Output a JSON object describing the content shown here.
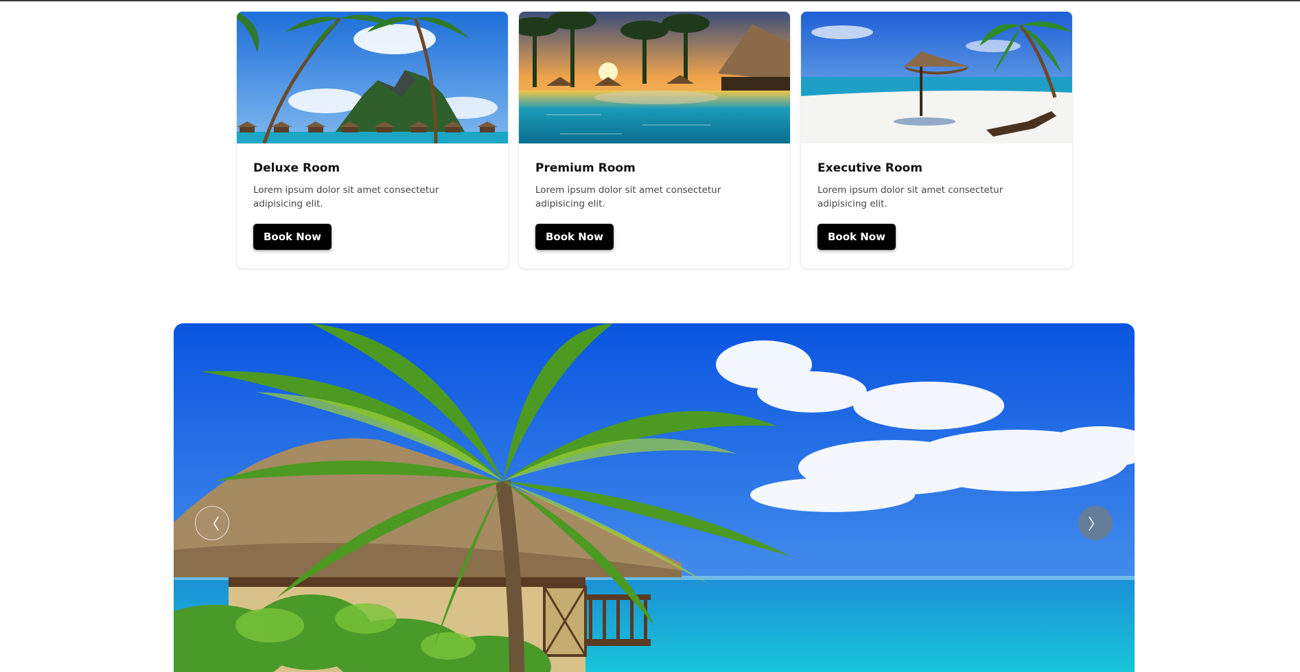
{
  "rooms": [
    {
      "title": "Deluxe Room",
      "description": "Lorem ipsum dolor sit amet consectetur adipisicing elit.",
      "button": "Book Now",
      "image": "tropical-island-overwater-bungalows"
    },
    {
      "title": "Premium Room",
      "description": "Lorem ipsum dolor sit amet consectetur adipisicing elit.",
      "button": "Book Now",
      "image": "resort-pool-at-sunset"
    },
    {
      "title": "Executive Room",
      "description": "Lorem ipsum dolor sit amet consectetur adipisicing elit.",
      "button": "Book Now",
      "image": "beach-umbrella-and-palm"
    }
  ],
  "carousel": {
    "image": "thatched-hut-palm-tree-lagoon",
    "prev_icon": "chevron-left-icon",
    "next_icon": "chevron-right-icon",
    "prev_glyph": "〈",
    "next_glyph": "〉"
  },
  "colors": {
    "button_bg": "#000000",
    "button_text": "#ffffff",
    "card_bg": "#ffffff"
  }
}
